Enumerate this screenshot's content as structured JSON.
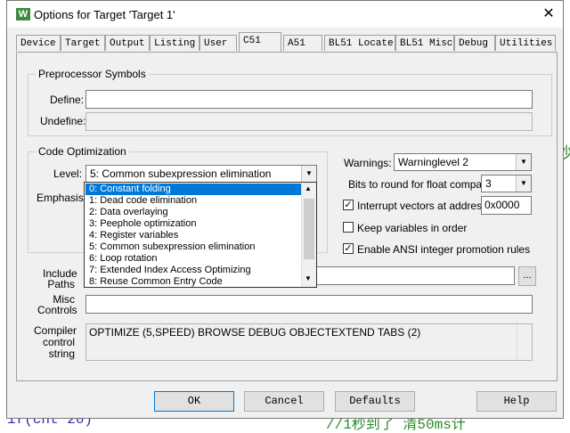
{
  "background": {
    "code_bottom": "if(cnt  20)",
    "comment_bottom": "//1秒到了  清50ms计",
    "fragment_right": "秒"
  },
  "dialog": {
    "title": "Options for Target 'Target 1'",
    "icon_letter": "W",
    "close_glyph": "✕"
  },
  "tabs": [
    {
      "label": "Device"
    },
    {
      "label": "Target"
    },
    {
      "label": "Output"
    },
    {
      "label": "Listing"
    },
    {
      "label": "User"
    },
    {
      "label": "C51"
    },
    {
      "label": "A51"
    },
    {
      "label": "BL51 Locate"
    },
    {
      "label": "BL51 Misc"
    },
    {
      "label": "Debug"
    },
    {
      "label": "Utilities"
    }
  ],
  "preprocessor": {
    "title": "Preprocessor Symbols",
    "define_label": "Define:",
    "define_value": "",
    "undefine_label": "Undefine:",
    "undefine_value": ""
  },
  "optimization": {
    "title": "Code Optimization",
    "level_label": "Level:",
    "level_value": "5: Common subexpression elimination",
    "emphasis_label": "Emphasis:",
    "options": [
      "0: Constant folding",
      "1: Dead code elimination",
      "2: Data overlaying",
      "3: Peephole optimization",
      "4: Register variables",
      "5: Common subexpression elimination",
      "6: Loop rotation",
      "7: Extended Index Access Optimizing",
      "8: Reuse Common Entry Code"
    ],
    "highlighted_index": 0
  },
  "right_options": {
    "warnings_label": "Warnings:",
    "warnings_value": "Warninglevel 2",
    "bits_label": "Bits to round for float compare:",
    "bits_value": "3",
    "interrupt_label": "Interrupt vectors at address:",
    "interrupt_checked": true,
    "interrupt_value": "0x0000",
    "keep_label": "Keep variables in order",
    "keep_checked": false,
    "ansi_label": "Enable ANSI integer promotion rules",
    "ansi_checked": true
  },
  "paths": {
    "include_label_1": "Include",
    "include_label_2": "Paths",
    "include_value": "",
    "browse_label": "...",
    "misc_label_1": "Misc",
    "misc_label_2": "Controls",
    "misc_value": "",
    "compiler_label_1": "Compiler",
    "compiler_label_2": "control",
    "compiler_label_3": "string",
    "compiler_value": "OPTIMIZE (5,SPEED) BROWSE DEBUG OBJECTEXTEND TABS (2)"
  },
  "buttons": {
    "ok": "OK",
    "cancel": "Cancel",
    "defaults": "Defaults",
    "help": "Help"
  },
  "colors": {
    "selection": "#0078d7",
    "dialog_bg": "#f0f0f0",
    "bg_code": "#2b2bb0"
  },
  "icons": {
    "dropdown": "chevron-down-icon",
    "close": "close-icon",
    "check": "checkmark-icon"
  }
}
